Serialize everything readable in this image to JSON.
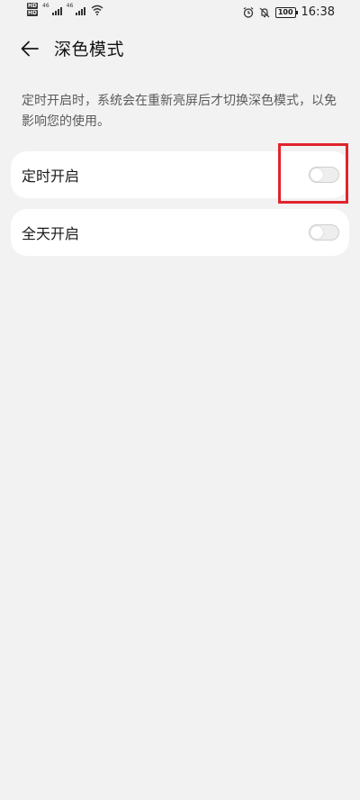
{
  "status_bar": {
    "sim1_tag": "HD",
    "sim2_tag": "HD",
    "network1": "46",
    "network2": "46",
    "battery": "100",
    "time": "16:38",
    "icons": [
      "signal-icon",
      "wifi-icon",
      "alarm-icon",
      "mute-bell-icon",
      "battery-icon"
    ]
  },
  "header": {
    "back_icon": "arrow-left-icon",
    "title": "深色模式"
  },
  "description": "定时开启时，系统会在重新亮屏后才切换深色模式，以免影响您的使用。",
  "settings": [
    {
      "label": "定时开启",
      "enabled": false
    },
    {
      "label": "全天开启",
      "enabled": false
    }
  ],
  "colors": {
    "background": "#f2f2f2",
    "card": "#ffffff",
    "highlight": "#e0242c"
  }
}
